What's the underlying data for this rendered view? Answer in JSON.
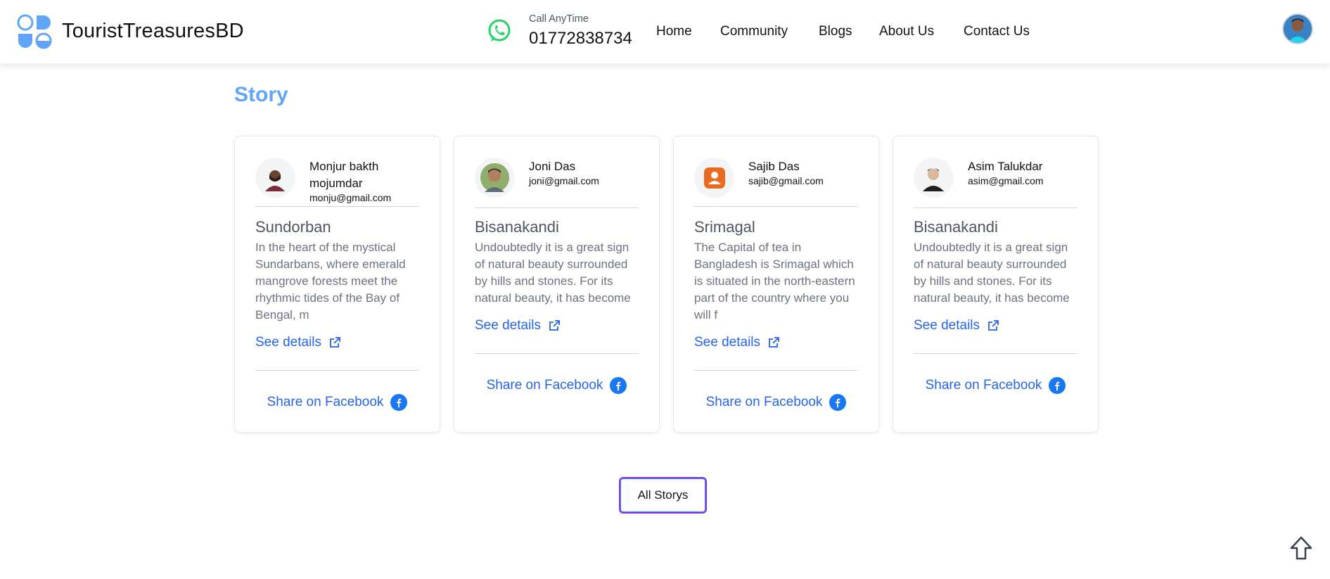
{
  "header": {
    "brand": "TouristTreasuresBD",
    "call_label": "Call AnyTime",
    "call_number": "01772838734",
    "nav": [
      "Home",
      "Community",
      "Blogs",
      "About Us",
      "Contact Us"
    ]
  },
  "section": {
    "title": "Story"
  },
  "stories": [
    {
      "author": "Monjur bakth mojumdar",
      "email": "monju@gmail.com",
      "place": "Sundorban",
      "description": "In the heart of the mystical Sundarbans, where emerald mangrove forests meet the rhythmic tides of the Bay of Bengal, m",
      "see_details": "See details",
      "share": "Share on Facebook"
    },
    {
      "author": "Joni Das",
      "email": "joni@gmail.com",
      "place": "Bisanakandi",
      "description": "Undoubtedly it is a great sign of natural beauty surrounded by hills and stones. For its natural beauty, it has become a",
      "see_details": "See details",
      "share": "Share on Facebook"
    },
    {
      "author": "Sajib Das",
      "email": "sajib@gmail.com",
      "place": "Srimagal",
      "description": "The Capital of tea in Bangladesh is Srimagal which is situated in the north-eastern part of the country where you will f",
      "see_details": "See details",
      "share": "Share on Facebook"
    },
    {
      "author": "Asim Talukdar",
      "email": "asim@gmail.com",
      "place": "Bisanakandi",
      "description": "Undoubtedly it is a great sign of natural beauty surrounded by hills and stones. For its natural beauty, it has become a",
      "see_details": "See details",
      "share": "Share on Facebook"
    }
  ],
  "all_button": "All Storys",
  "icons": {
    "logo": "brand-logo-icon",
    "whatsapp": "whatsapp-icon",
    "external_link": "external-link-icon",
    "facebook": "facebook-icon",
    "scroll_top": "arrow-up-icon"
  },
  "colors": {
    "accent": "#2563eb",
    "title": "#60a5fa",
    "whatsapp": "#25d366",
    "facebook": "#1877f2",
    "button_border": "#7c3aed"
  }
}
